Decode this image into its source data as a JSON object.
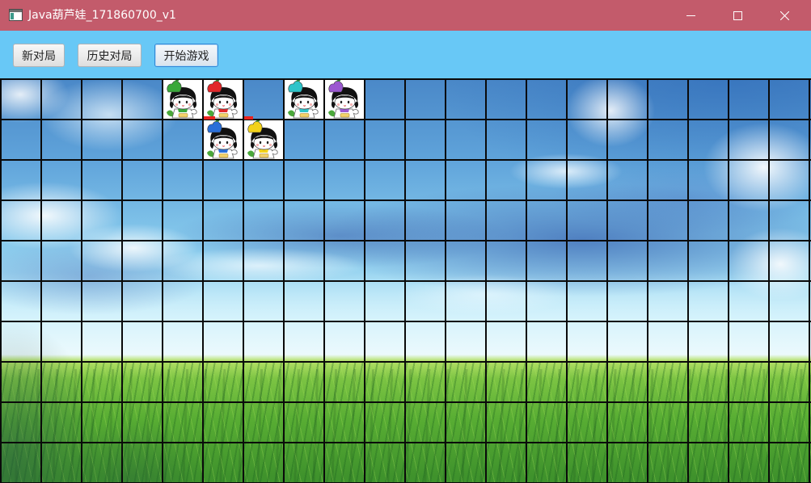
{
  "window": {
    "title": "Java葫芦娃_171860700_v1",
    "titlebar_color": "#c35b6b",
    "app_icon": "app-window-icon",
    "controls": {
      "minimize": "minimize-icon",
      "maximize": "maximize-icon",
      "close": "close-icon"
    }
  },
  "toolbar": {
    "background": "#68c8f6",
    "buttons": [
      {
        "label": "新对局"
      },
      {
        "label": "历史对局"
      },
      {
        "label": "开始游戏"
      }
    ]
  },
  "board": {
    "line_color": "#0a0a0a",
    "hp_color": "#e8231f",
    "pieces": [
      {
        "icon": "calabash-green",
        "hat_color": "#3aa83a",
        "row": 0,
        "col": 4
      },
      {
        "icon": "calabash-red",
        "hat_color": "#e2282a",
        "row": 0,
        "col": 5
      },
      {
        "icon": "calabash-cyan",
        "hat_color": "#2ec4c9",
        "row": 0,
        "col": 7
      },
      {
        "icon": "calabash-purple",
        "hat_color": "#9b59d0",
        "row": 0,
        "col": 8
      },
      {
        "icon": "calabash-blue",
        "hat_color": "#2a6fd8",
        "row": 1,
        "col": 5,
        "hp": 0.3
      },
      {
        "icon": "calabash-yellow",
        "hat_color": "#f2d21b",
        "row": 1,
        "col": 6,
        "hp": 0.23
      }
    ]
  }
}
